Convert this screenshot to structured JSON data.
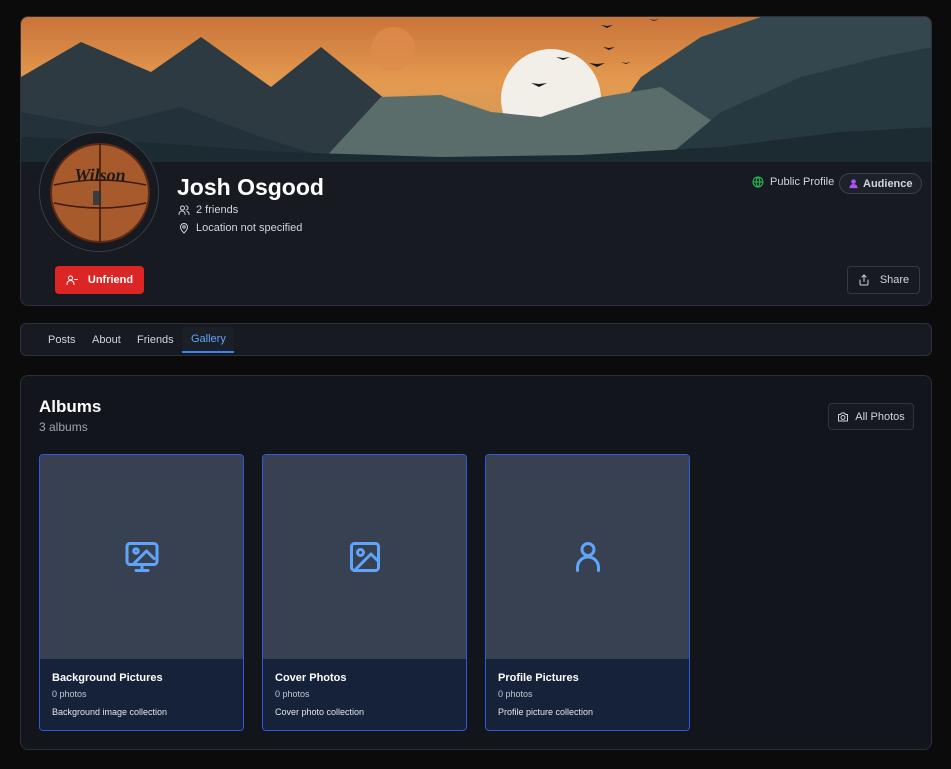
{
  "profile": {
    "name": "Josh Osgood",
    "friends": "2 friends",
    "location": "Location not specified",
    "public_label": "Public Profile",
    "audience_label": "Audience",
    "unfriend_label": "Unfriend",
    "share_label": "Share",
    "avatar_text": "Wilson"
  },
  "tabs": [
    {
      "label": "Posts"
    },
    {
      "label": "About"
    },
    {
      "label": "Friends"
    },
    {
      "label": "Gallery",
      "active": true
    }
  ],
  "albums": {
    "title": "Albums",
    "count": "3 albums",
    "all_photos_label": "All Photos",
    "items": [
      {
        "name": "Background Pictures",
        "photos": "0 photos",
        "description": "Background image collection",
        "icon": "image-display-icon"
      },
      {
        "name": "Cover Photos",
        "photos": "0 photos",
        "description": "Cover photo collection",
        "icon": "image-icon"
      },
      {
        "name": "Profile Pictures",
        "photos": "0 photos",
        "description": "Profile picture collection",
        "icon": "user-icon"
      }
    ]
  },
  "colors": {
    "accent": "#60a5fa",
    "danger": "#dc2626",
    "card_border": "#2f5bd6",
    "public_icon": "#22c55e",
    "audience_icon": "#a855f7"
  }
}
